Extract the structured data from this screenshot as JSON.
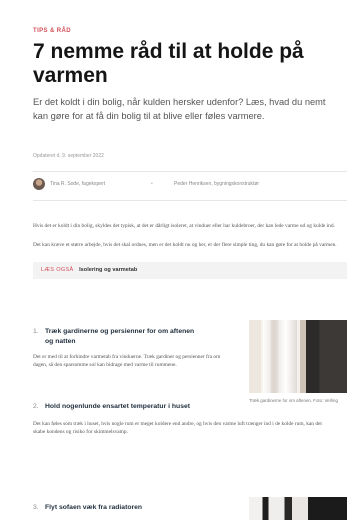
{
  "article": {
    "eyebrow": "TIPS & RÅD",
    "title": "7 nemme råd til at holde på varmen",
    "subtitle": "Er det koldt i din bolig, når kulden hersker udenfor? Læs, hvad du nemt kan gøre for at få din bolig til at blive eller føles varmere.",
    "updated": "Opdateret d. 9. september 2022"
  },
  "authors": {
    "author1": "Tina R. Sode, fagekspert",
    "separator": "•",
    "author2": "Peder Henriksen, bygningskonstruktør"
  },
  "intro": {
    "p1": "Hvis det er koldt i din bolig, skyldes det typisk, at det er dårligt isoleret, at vinduer eller har kuldebroer, der kan lede varme ud og kulde ind.",
    "p2": "Det kan kræve et større arbejde, hvis det skal ordnes, men er det koldt nu og her, er der flere simple ting, du kan gøre for at holde på varmen."
  },
  "related": {
    "tag": "LÆS OGSÅ",
    "link": "Isolering og varmetab"
  },
  "tips": [
    {
      "number": "1.",
      "heading_line1": "Træk gardinerne og persienner for om aftenen",
      "heading_line2": "og natten",
      "body": "Det er med til at forhindre varmetab fra vinduerne. Træk gardiner og persienner fra om dagen, så den sparsomme sol kan bidrage med varme til rummene."
    },
    {
      "number": "2.",
      "heading_line1": "Hold nogenlunde ensartet temperatur i huset",
      "body": "Det kan føles som træk i huset, hvis nogle rum er meget koldere end andre, og hvis den varme luft trænger ind i de kolde rum, kan det skabe kondens og risiko for skimmelsvamp."
    },
    {
      "number": "3.",
      "heading_line1": "Flyt sofaen væk fra radiatoren"
    }
  ],
  "photo": {
    "caption": "Træk gardinerne for om aftenen. Foto: Verling"
  }
}
